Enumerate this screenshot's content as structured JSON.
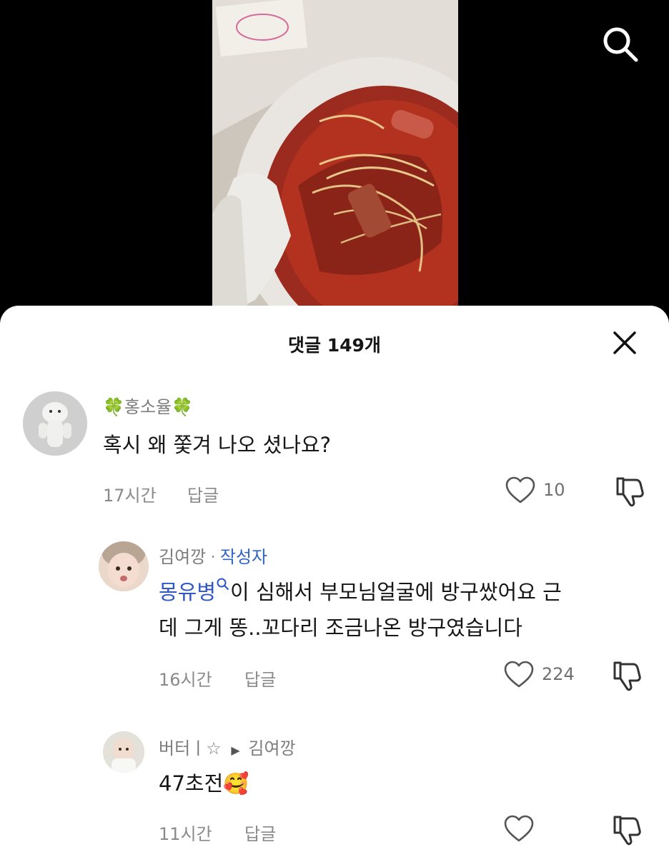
{
  "header": {
    "search_icon": "search-icon"
  },
  "comments_sheet": {
    "title": "댓글 149개",
    "close_icon": "close-icon"
  },
  "comments": [
    {
      "username": "🍀홍소율🍀",
      "text": "혹시 왜 쫓겨 나오 셨나요?",
      "time": "17시간",
      "reply_label": "답글",
      "likes": "10"
    },
    {
      "username": "김여깡",
      "author_tag": "작성자",
      "mention": "몽유병",
      "text_line1": "이 심해서 부모님얼굴에 방구쌌어요 근",
      "text_line2": "데 그게 똥..꼬다리 조금나온 방구였습니다",
      "time": "16시간",
      "reply_label": "답글",
      "likes": "224"
    },
    {
      "username": "버터ㅣ☆",
      "reply_to": "김여깡",
      "text": "47초전",
      "emoji": "🥰",
      "time": "11시간",
      "reply_label": "답글",
      "likes": ""
    }
  ]
}
